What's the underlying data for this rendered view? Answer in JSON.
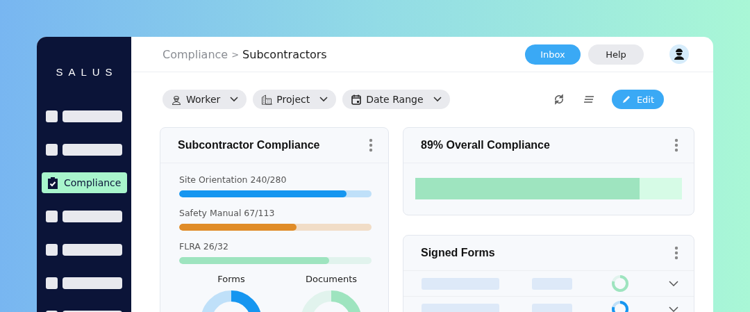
{
  "sidebar": {
    "logo": "SALUS",
    "items": [
      {
        "kind": "placeholder",
        "selected": false
      },
      {
        "kind": "placeholder",
        "selected": false
      },
      {
        "kind": "link",
        "label": "Compliance",
        "selected": true
      },
      {
        "kind": "placeholder",
        "selected": false
      },
      {
        "kind": "placeholder",
        "selected": false
      },
      {
        "kind": "placeholder",
        "selected": false
      },
      {
        "kind": "placeholder",
        "selected": false
      }
    ]
  },
  "breadcrumb": {
    "parent": "Compliance",
    "separator": ">",
    "current": "Subcontractors"
  },
  "header_buttons": [
    {
      "label": "Inbox",
      "primary": true
    },
    {
      "label": "Help",
      "primary": false
    }
  ],
  "filters": [
    {
      "kind": "worker",
      "label": "Worker"
    },
    {
      "kind": "project",
      "label": "Project"
    },
    {
      "kind": "date",
      "label": "Date Range"
    }
  ],
  "edit_button": "Edit",
  "subcontractor_card": {
    "title": "Subcontractor Compliance",
    "bars": [
      {
        "label": "Site Orientation 240/280",
        "level": 0.87,
        "color": "#1696f0"
      },
      {
        "label": "Safety Manual 67/113",
        "level": 0.61,
        "color": "#e08c28"
      },
      {
        "label": "FLRA 26/32",
        "level": 0.78,
        "color": "#9ee4bf"
      }
    ],
    "donuts": [
      {
        "label": "Forms",
        "color": "#1696f0"
      },
      {
        "label": "Documents",
        "color": "#9ee4bf"
      }
    ]
  },
  "overall_card": {
    "title": "89% Overall Compliance",
    "level": 0.84
  },
  "signed_forms": {
    "title": "Signed Forms",
    "rows": [
      {
        "color": "#9ee4bf"
      },
      {
        "color": "#1696f0"
      }
    ]
  }
}
